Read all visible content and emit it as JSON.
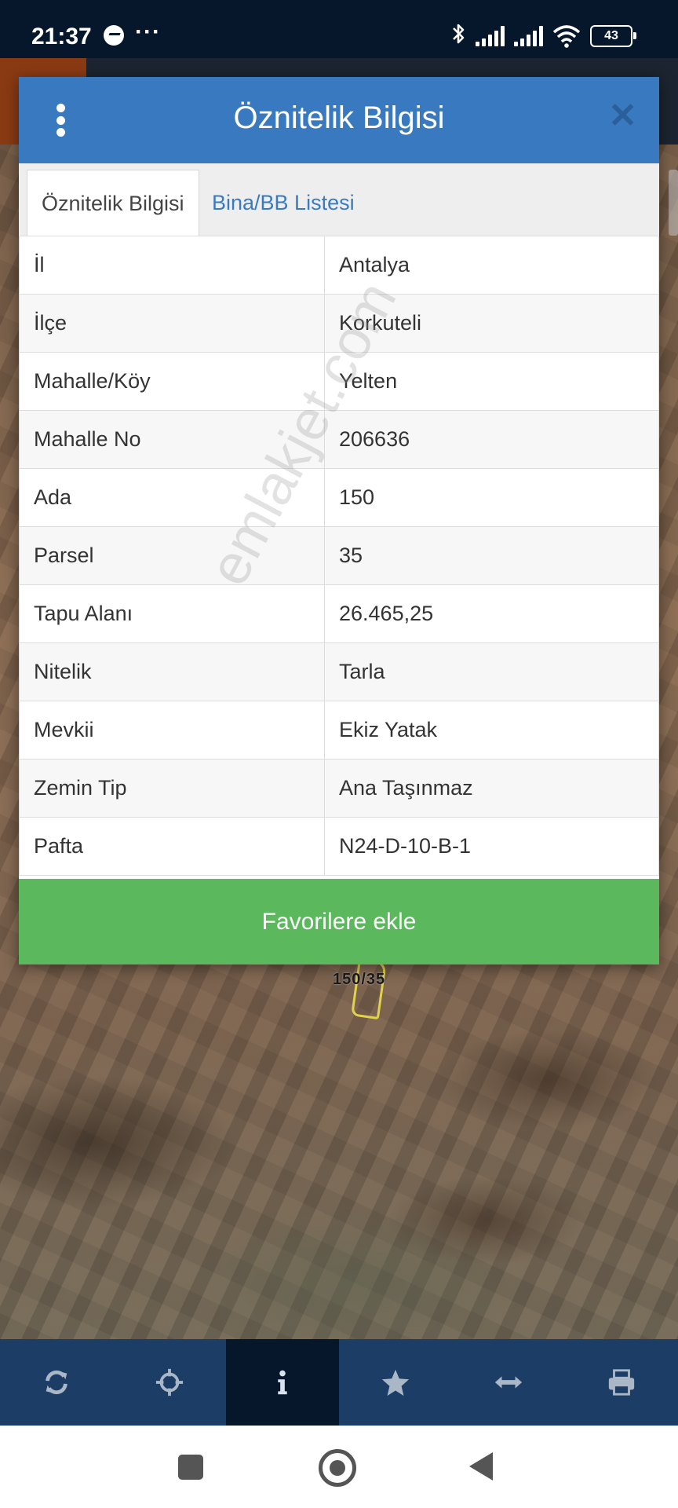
{
  "status_bar": {
    "time": "21:37",
    "more": "···",
    "battery": "43"
  },
  "map": {
    "parcel_label": "150/35"
  },
  "dialog": {
    "title": "Öznitelik Bilgisi",
    "tabs": [
      {
        "label": "Öznitelik Bilgisi",
        "active": true
      },
      {
        "label": "Bina/BB Listesi",
        "active": false
      }
    ],
    "rows": [
      {
        "key": "İl",
        "value": "Antalya"
      },
      {
        "key": "İlçe",
        "value": "Korkuteli"
      },
      {
        "key": "Mahalle/Köy",
        "value": "Yelten"
      },
      {
        "key": "Mahalle No",
        "value": "206636"
      },
      {
        "key": "Ada",
        "value": "150"
      },
      {
        "key": "Parsel",
        "value": "35"
      },
      {
        "key": "Tapu Alanı",
        "value": "26.465,25"
      },
      {
        "key": "Nitelik",
        "value": "Tarla"
      },
      {
        "key": "Mevkii",
        "value": "Ekiz Yatak"
      },
      {
        "key": "Zemin Tip",
        "value": "Ana Taşınmaz"
      },
      {
        "key": "Pafta",
        "value": "N24-D-10-B-1"
      }
    ],
    "favorite_label": "Favorilere ekle"
  },
  "watermark": "emlakjet.com",
  "toolbar": {
    "items": [
      {
        "icon": "refresh-icon",
        "active": false
      },
      {
        "icon": "crosshairs-icon",
        "active": false
      },
      {
        "icon": "info-icon",
        "active": true
      },
      {
        "icon": "star-icon",
        "active": false
      },
      {
        "icon": "arrows-horizontal-icon",
        "active": false
      },
      {
        "icon": "print-icon",
        "active": false
      }
    ]
  },
  "colors": {
    "header": "#3979bf",
    "favorite": "#5cb85c",
    "toolbar": "#1c3d66",
    "toolbar_active": "#06162b",
    "tab_link": "#3a7bc0"
  }
}
